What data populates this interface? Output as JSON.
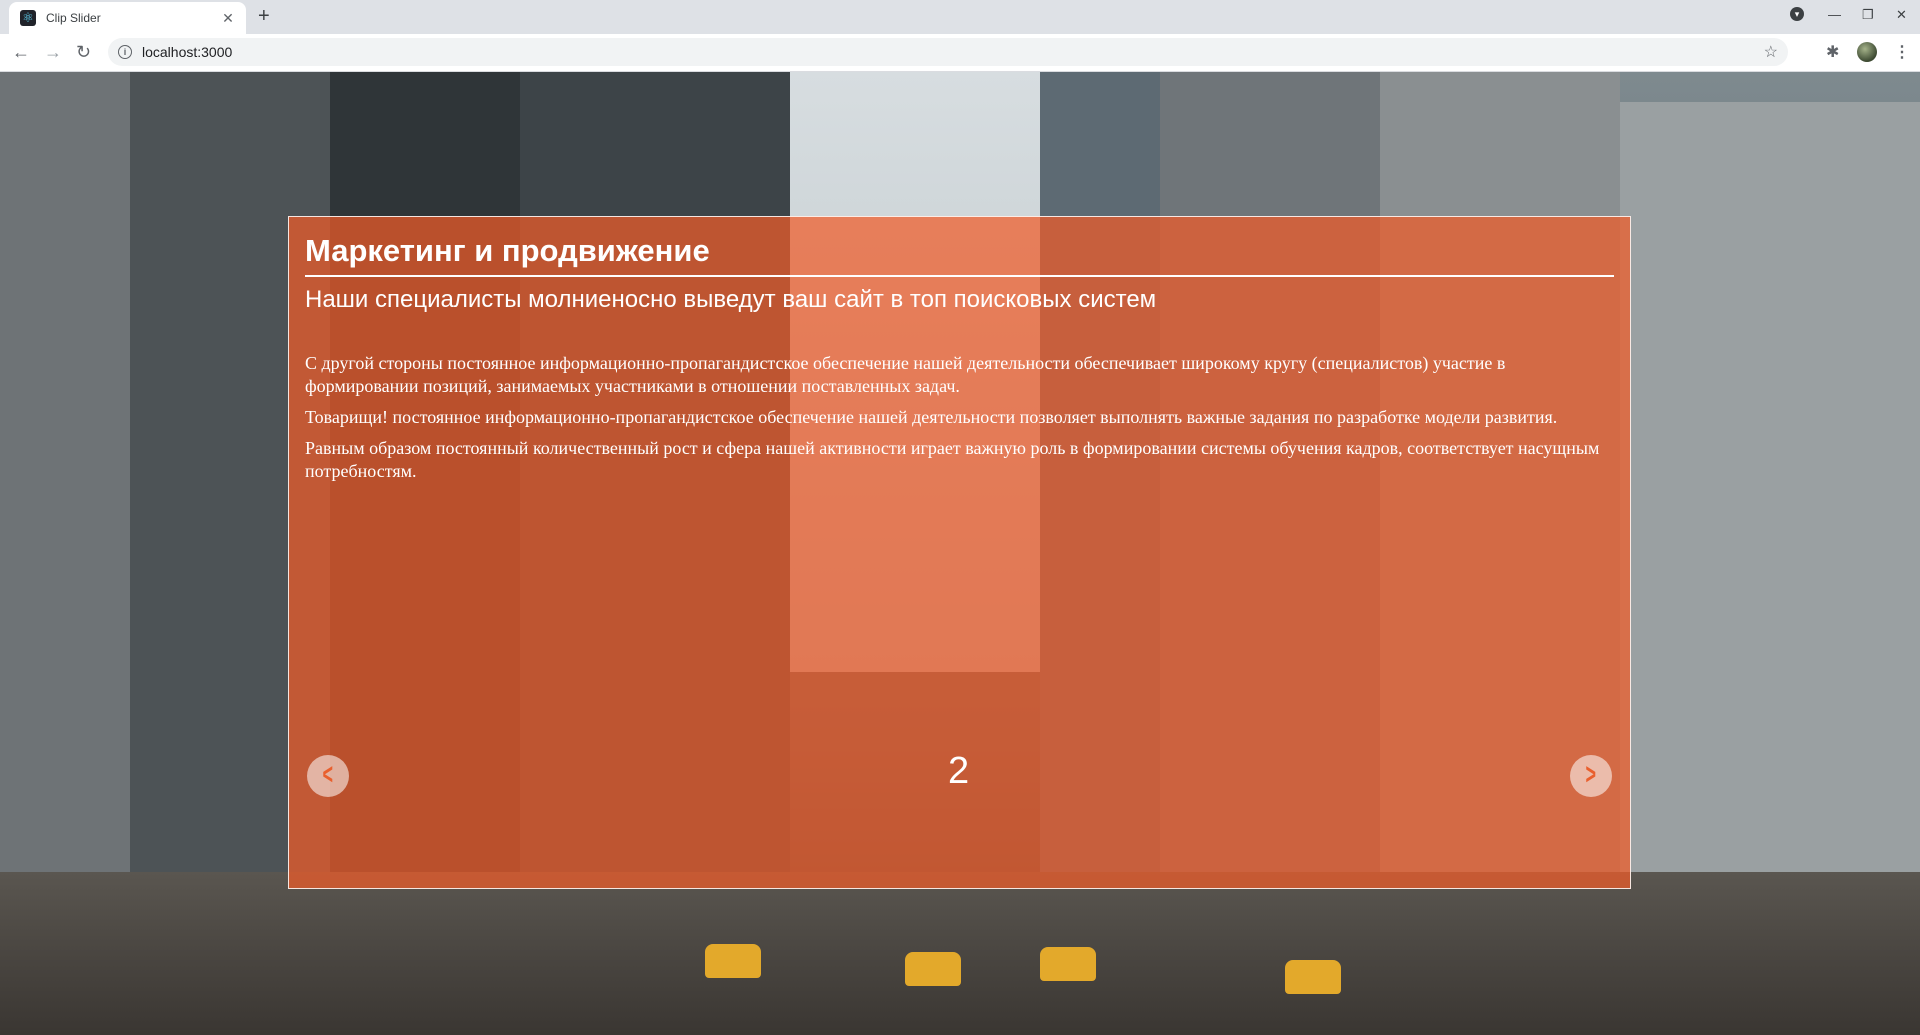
{
  "browser": {
    "tab_title": "Clip Slider",
    "tab_favicon": "react-favicon",
    "url": "localhost:3000",
    "icons": [
      "back-arrow-icon",
      "forward-arrow-icon",
      "reload-icon",
      "info-icon",
      "star-icon",
      "extensions-icon",
      "avatar",
      "menu-icon",
      "close-icon",
      "new-tab-icon",
      "minimize-icon",
      "restore-icon"
    ]
  },
  "slide": {
    "title": "Маркетинг и продвижение",
    "subtitle": "Наши специалисты молниеносно выведут ваш сайт в топ поисковых систем",
    "paragraphs": [
      "С другой стороны постоянное информационно-пропагандистское обеспечение нашей деятельности обеспечивает широкому кругу (специалистов) участие в формировании позиций, занимаемых участниками в отношении поставленных задач.",
      "Товарищи! постоянное информационно-пропагандистское обеспечение нашей деятельности позволяет выполнять важные задания по разработке модели развития.",
      "Равным образом постоянный количественный рост и сфера нашей активности играет важную роль в формировании системы обучения кадров, соответствует насущным потребностям."
    ],
    "number": "2",
    "prev_label": "<",
    "next_label": ">",
    "overlay_color": "#f05c28"
  }
}
